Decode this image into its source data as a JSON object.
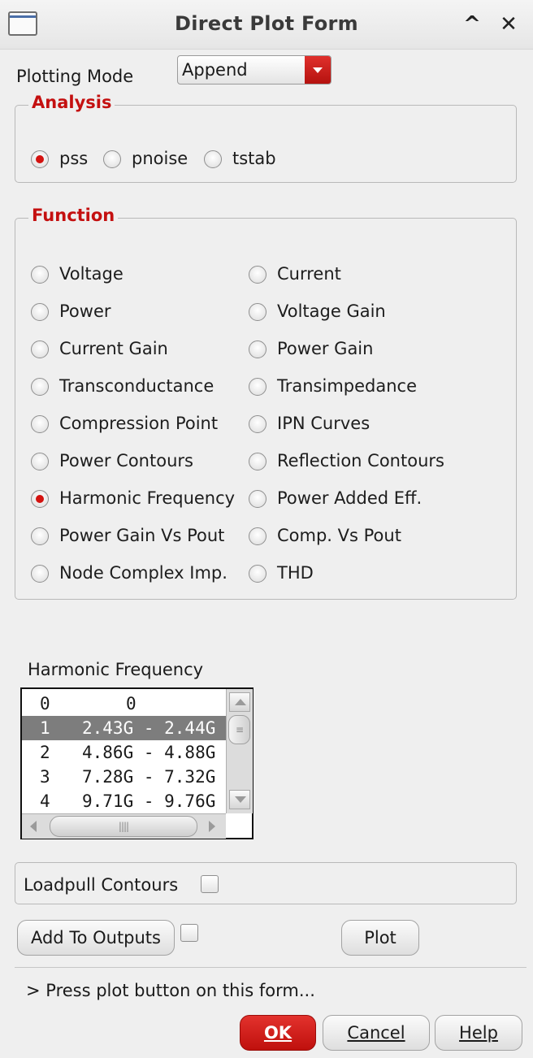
{
  "window": {
    "title": "Direct Plot Form",
    "min_glyph": "^",
    "close_glyph": "✕"
  },
  "plotting_mode": {
    "label": "Plotting Mode",
    "value": "Append"
  },
  "analysis": {
    "title": "Analysis",
    "options": [
      {
        "label": "pss",
        "checked": true
      },
      {
        "label": "pnoise",
        "checked": false
      },
      {
        "label": "tstab",
        "checked": false
      }
    ]
  },
  "function": {
    "title": "Function",
    "left": [
      {
        "label": "Voltage",
        "checked": false
      },
      {
        "label": "Power",
        "checked": false
      },
      {
        "label": "Current Gain",
        "checked": false
      },
      {
        "label": "Transconductance",
        "checked": false
      },
      {
        "label": "Compression Point",
        "checked": false
      },
      {
        "label": "Power Contours",
        "checked": false
      },
      {
        "label": "Harmonic Frequency",
        "checked": true
      },
      {
        "label": "Power Gain Vs Pout",
        "checked": false
      },
      {
        "label": "Node Complex Imp.",
        "checked": false
      }
    ],
    "right": [
      {
        "label": "Current",
        "checked": false
      },
      {
        "label": "Voltage Gain",
        "checked": false
      },
      {
        "label": "Power Gain",
        "checked": false
      },
      {
        "label": "Transimpedance",
        "checked": false
      },
      {
        "label": "IPN Curves",
        "checked": false
      },
      {
        "label": "Reflection Contours",
        "checked": false
      },
      {
        "label": "Power Added Eff.",
        "checked": false
      },
      {
        "label": "Comp. Vs Pout",
        "checked": false
      },
      {
        "label": "THD",
        "checked": false
      }
    ]
  },
  "harmonic": {
    "label": "Harmonic Frequency",
    "rows": [
      {
        "index": "0",
        "freq": "0",
        "selected": false
      },
      {
        "index": "1",
        "freq": "2.43G - 2.44G",
        "selected": true
      },
      {
        "index": "2",
        "freq": "4.86G - 4.88G",
        "selected": false
      },
      {
        "index": "3",
        "freq": "7.28G - 7.32G",
        "selected": false
      },
      {
        "index": "4",
        "freq": "9.71G - 9.76G",
        "selected": false
      }
    ]
  },
  "loadpull": {
    "label": "Loadpull Contours",
    "checked": false
  },
  "buttons": {
    "add_to_outputs": "Add To Outputs",
    "plot": "Plot",
    "ok": "OK",
    "cancel": "Cancel",
    "help": "Help"
  },
  "status": {
    "message": "> Press plot button on this form..."
  },
  "colors": {
    "accent": "#c41010",
    "radio_dot": "#d3120f",
    "ok_button": "#d0201c"
  }
}
